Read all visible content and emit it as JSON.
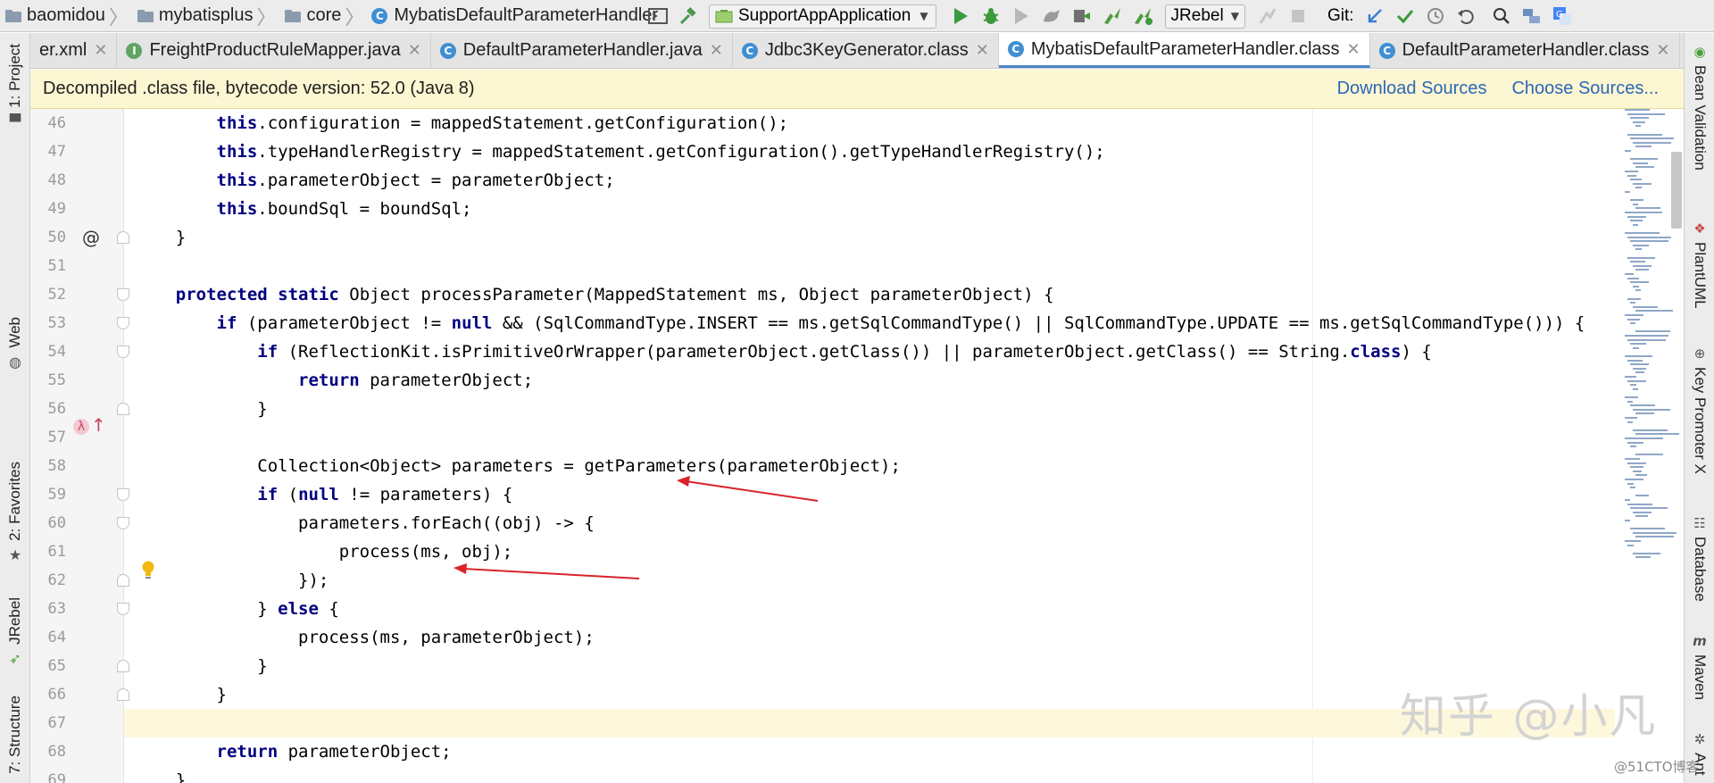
{
  "breadcrumb": {
    "items": [
      {
        "label": "baomidou",
        "kind": "folder"
      },
      {
        "label": "mybatisplus",
        "kind": "folder"
      },
      {
        "label": "core",
        "kind": "folder"
      },
      {
        "label": "MybatisDefaultParameterHandler",
        "kind": "class"
      }
    ]
  },
  "toolbar": {
    "run_config": "SupportAppApplication",
    "jrebel_select": "JRebel",
    "git_label": "Git:"
  },
  "tabs": [
    {
      "label": "er.xml",
      "icon": "xml-icon",
      "active": false
    },
    {
      "label": "FreightProductRuleMapper.java",
      "icon": "interface-icon",
      "active": false
    },
    {
      "label": "DefaultParameterHandler.java",
      "icon": "class-icon",
      "active": false
    },
    {
      "label": "Jdbc3KeyGenerator.class",
      "icon": "class-icon",
      "active": false
    },
    {
      "label": "MybatisDefaultParameterHandler.class",
      "icon": "class-icon",
      "active": true
    },
    {
      "label": "DefaultParameterHandler.class",
      "icon": "class-icon",
      "active": false
    }
  ],
  "banner": {
    "text": "Decompiled .class file, bytecode version: 52.0 (Java 8)",
    "download_sources": "Download Sources",
    "choose_sources": "Choose Sources..."
  },
  "left_tools": [
    {
      "label": "1: Project",
      "icon": "folder-icon"
    },
    {
      "label": "Web",
      "icon": "globe-icon"
    },
    {
      "label": "2: Favorites",
      "icon": "star-icon"
    },
    {
      "label": "JRebel",
      "icon": "jrebel-icon"
    },
    {
      "label": "7: Structure",
      "icon": "structure-icon"
    }
  ],
  "right_tools": [
    {
      "label": "Bean Validation",
      "icon": "bean-validation-icon"
    },
    {
      "label": "PlantUML",
      "icon": "plantuml-icon"
    },
    {
      "label": "Key Promoter X",
      "icon": "key-promoter-icon"
    },
    {
      "label": "Database",
      "icon": "database-icon"
    },
    {
      "label": "Maven",
      "icon": "maven-icon"
    },
    {
      "label": "Ant",
      "icon": "ant-icon"
    }
  ],
  "code": {
    "current_line": 67,
    "lines": [
      {
        "n": "46",
        "text": "        this.configuration = mappedStatement.getConfiguration();"
      },
      {
        "n": "47",
        "text": "        this.typeHandlerRegistry = mappedStatement.getConfiguration().getTypeHandlerRegistry();"
      },
      {
        "n": "48",
        "text": "        this.parameterObject = parameterObject;"
      },
      {
        "n": "49",
        "text": "        this.boundSql = boundSql;"
      },
      {
        "n": "50",
        "text": "    }"
      },
      {
        "n": "51",
        "text": ""
      },
      {
        "n": "52",
        "text": "    protected static Object processParameter(MappedStatement ms, Object parameterObject) {"
      },
      {
        "n": "53",
        "text": "        if (parameterObject != null && (SqlCommandType.INSERT == ms.getSqlCommandType() || SqlCommandType.UPDATE == ms.getSqlCommandType())) {"
      },
      {
        "n": "54",
        "text": "            if (ReflectionKit.isPrimitiveOrWrapper(parameterObject.getClass()) || parameterObject.getClass() == String.class) {"
      },
      {
        "n": "55",
        "text": "                return parameterObject;"
      },
      {
        "n": "56",
        "text": "            }"
      },
      {
        "n": "57",
        "text": ""
      },
      {
        "n": "58",
        "text": "            Collection<Object> parameters = getParameters(parameterObject);"
      },
      {
        "n": "59",
        "text": "            if (null != parameters) {"
      },
      {
        "n": "60",
        "text": "                parameters.forEach((obj) -> {"
      },
      {
        "n": "61",
        "text": "                    process(ms, obj);"
      },
      {
        "n": "62",
        "text": "                });"
      },
      {
        "n": "63",
        "text": "            } else {"
      },
      {
        "n": "64",
        "text": "                process(ms, parameterObject);"
      },
      {
        "n": "65",
        "text": "            }"
      },
      {
        "n": "66",
        "text": "        }"
      },
      {
        "n": "67",
        "text": ""
      },
      {
        "n": "68",
        "text": "        return parameterObject;"
      },
      {
        "n": "69",
        "text": "    }"
      }
    ]
  },
  "watermark": {
    "text": "知乎 @小凡",
    "source": "@51CTO博客"
  },
  "colors": {
    "keyword": "#000080",
    "banner_bg": "#fdf6d2",
    "link": "#2b67b7",
    "annotation_arrow": "#d9232b"
  }
}
